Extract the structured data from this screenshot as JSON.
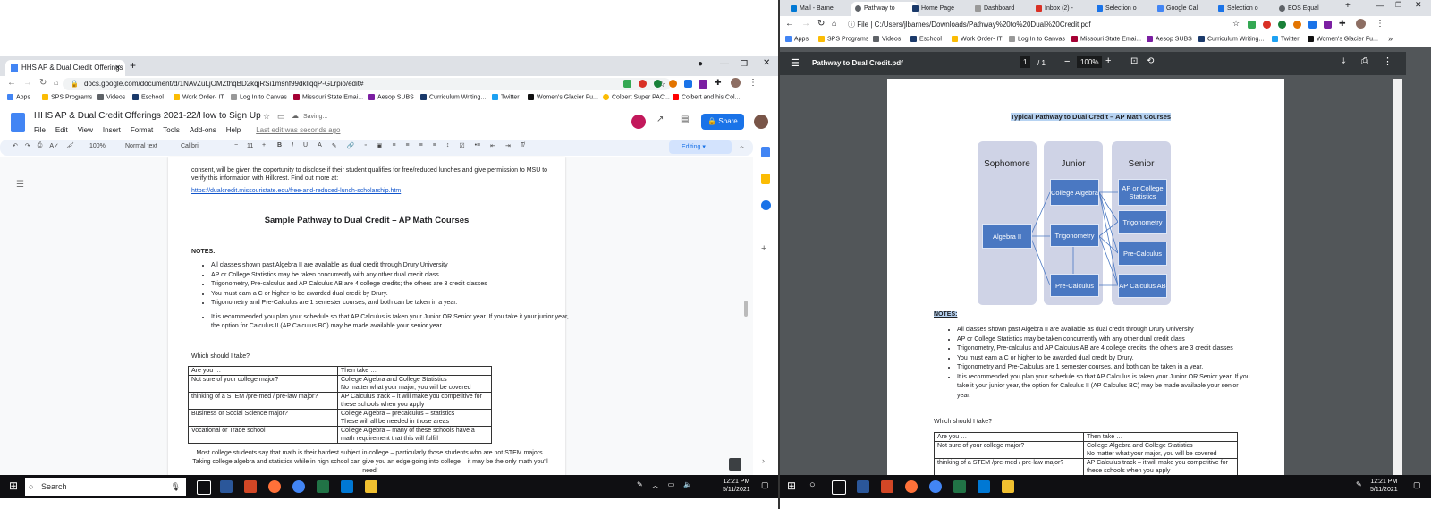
{
  "left": {
    "tab_title": "HHS AP & Dual Credit Offerings 2",
    "url": "docs.google.com/document/d/1NAvZuLjOMZthqBD2kqjRSi1msnf99dkllqqP-GLrpio/edit#",
    "bookmarks": [
      "Apps",
      "SPS Programs",
      "Videos",
      "Eschool",
      "Work Order- IT",
      "Log In to Canvas",
      "Missouri State Emai...",
      "Aesop SUBS",
      "Curriculum Writing...",
      "Twitter",
      "Women's Glacier Fu...",
      "Colbert Super PAC...",
      "Colbert and his Col..."
    ],
    "doc_title": "HHS AP & Dual Credit Offerings 2021-22/How to Sign Up",
    "saving": "Saving...",
    "menus": [
      "File",
      "Edit",
      "View",
      "Insert",
      "Format",
      "Tools",
      "Add-ons",
      "Help"
    ],
    "last_edit": "Last edit was seconds ago",
    "share": "Share",
    "zoom": "100%",
    "style": "Normal text",
    "font": "Calibri",
    "font_size": "11",
    "mode": "Editing",
    "para1": "consent, will be given the opportunity to disclose if their student qualifies for free/reduced lunches and give permission to MSU to verify this information with Hillcrest. Find out more at:",
    "link": "https://dualcredit.missouristate.edu/free-and-reduced-lunch-scholarship.htm",
    "heading": "Sample Pathway to Dual Credit – AP Math Courses",
    "notes_label": "NOTES:",
    "notes": [
      "All classes shown past Algebra II are available as dual credit through Drury University",
      "AP or College Statistics may be taken concurrently with any other dual credit class",
      "Trigonometry, Pre-calculus and AP Calculus AB are 4 college credits; the others are 3 credit classes",
      "You must earn a C or higher to be awarded dual credit by Drury.",
      "Trigonometry and Pre-Calculus are 1 semester courses, and both can be taken in a year.",
      "It is recommended you plan your schedule so that AP Calculus is taken your Junior OR Senior year.  If you take it your junior year, the option for Calculus II (AP Calculus BC) may be made available your senior year."
    ],
    "which": "Which should I take?",
    "table": [
      [
        "Are you …",
        "Then take …"
      ],
      [
        "Not sure of your college major?",
        "College Algebra and College Statistics\nNo matter what your major, you will be covered"
      ],
      [
        "thinking of a STEM /pre-med / pre-law major?",
        "AP Calculus track – it will make you competitive for these schools when you apply"
      ],
      [
        "Business or Social Science major?",
        "College Algebra – precalculus – statistics\nThese will all be needed in those areas"
      ],
      [
        "Vocational or Trade school",
        "College Algebra – many of these schools have a math requirement that this will fulfill"
      ]
    ],
    "closing": "Most college students say that math is their hardest subject in college – particularly those students who are not STEM majors.  Taking college algebra and statistics while in high school can give you an edge going into college – it may be the only math you'll need!"
  },
  "right": {
    "tabs": [
      "Mail - Barne",
      "Pathway to",
      "Home Page",
      "Dashboard",
      "Inbox (2) -",
      "Selection o",
      "Google Cal",
      "Selection o",
      "EOS Equal"
    ],
    "url_prefix": "File",
    "url": "C:/Users/jlbarnes/Downloads/Pathway%20to%20Dual%20Credit.pdf",
    "bookmarks": [
      "Apps",
      "SPS Programs",
      "Videos",
      "Eschool",
      "Work Order- IT",
      "Log In to Canvas",
      "Missouri State Emai...",
      "Aesop SUBS",
      "Curriculum Writing...",
      "Twitter",
      "Women's Glacier Fu..."
    ],
    "pdf_title": "Pathway to Dual Credit.pdf",
    "page_current": "1",
    "page_total": "/  1",
    "zoom": "100%",
    "doc_heading": "Typical Pathway to Dual Credit – AP Math Courses",
    "columns": [
      "Sophomore",
      "Junior",
      "Senior"
    ],
    "boxes": {
      "algebra2": "Algebra II",
      "college_algebra": "College Algebra",
      "trigonometry": "Trigonometry",
      "precalculus": "Pre-Calculus",
      "ap_stats": "AP or College Statistics",
      "s_trig": "Trigonometry",
      "s_precalc": "Pre-Calculus",
      "ap_calc": "AP Calculus AB"
    },
    "notes_label": "NOTES:",
    "notes": [
      "All classes shown past Algebra II are available as dual credit through Drury University",
      "AP or College Statistics may be taken concurrently with any other dual credit class",
      "Trigonometry, Pre-calculus and AP Calculus AB are 4 college credits; the others are 3 credit classes",
      "You must earn a C or higher to be awarded dual credit by Drury.",
      "Trigonometry and Pre-Calculus are 1 semester courses, and both can be taken in a year.",
      "It is recommended you plan your schedule so that AP Calculus is taken your Junior OR Senior year.  If you take it your junior year, the option for Calculus II (AP Calculus BC) may be made available your senior year."
    ],
    "which": "Which should I take?",
    "table": [
      [
        "Are you …",
        "Then take …"
      ],
      [
        "Not sure of your college major?",
        "College Algebra and College Statistics\nNo matter what your major, you will be covered"
      ],
      [
        "thinking of a STEM /pre-med / pre-law major?",
        "AP Calculus track – it will make you competitive for these schools when you apply"
      ]
    ]
  },
  "taskbar": {
    "search": "Search",
    "time_left": "12:21 PM",
    "date_left": "5/11/2021",
    "time_right": "12:21 PM",
    "date_right": "5/11/2021"
  },
  "colors": {
    "share_blue": "#1a73e8",
    "flow_box": "#4a78c2",
    "flow_col": "#cfd3e6",
    "taskbar": "#0f0f12"
  }
}
